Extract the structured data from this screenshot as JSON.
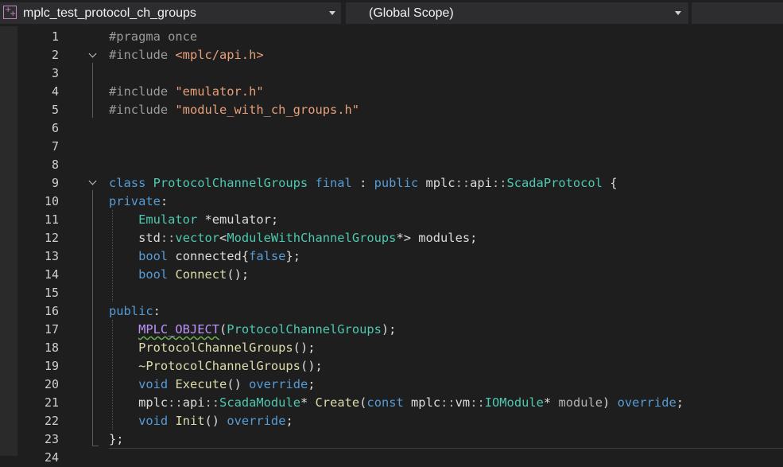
{
  "toolbar": {
    "project_dropdown": "mplc_test_protocol_ch_groups",
    "scope_dropdown": "(Global Scope)"
  },
  "editor": {
    "line_numbers": [
      "1",
      "2",
      "3",
      "4",
      "5",
      "6",
      "7",
      "8",
      "9",
      "10",
      "11",
      "12",
      "13",
      "14",
      "15",
      "16",
      "17",
      "18",
      "19",
      "20",
      "21",
      "22",
      "23",
      "24"
    ],
    "lines": [
      [
        [
          "pp",
          "#pragma once"
        ]
      ],
      [
        [
          "pp",
          "#include "
        ],
        [
          "str",
          "<mplc/api.h>"
        ]
      ],
      [],
      [
        [
          "pp",
          "#include "
        ],
        [
          "str",
          "\"emulator.h\""
        ]
      ],
      [
        [
          "pp",
          "#include "
        ],
        [
          "str",
          "\"module_with_ch_groups.h\""
        ]
      ],
      [],
      [],
      [],
      [
        [
          "kw",
          "class "
        ],
        [
          "ty",
          "ProtocolChannelGroups "
        ],
        [
          "kw",
          "final"
        ],
        [
          "id",
          " : "
        ],
        [
          "kw",
          "public "
        ],
        [
          "id",
          "mplc"
        ],
        [
          "pt",
          "::"
        ],
        [
          "id",
          "api"
        ],
        [
          "pt",
          "::"
        ],
        [
          "ty",
          "ScadaProtocol"
        ],
        [
          "id",
          " {"
        ]
      ],
      [
        [
          "kw",
          "private"
        ],
        [
          "id",
          ":"
        ]
      ],
      [
        [
          "id",
          "    "
        ],
        [
          "ty",
          "Emulator"
        ],
        [
          "id",
          " *emulator;"
        ]
      ],
      [
        [
          "id",
          "    std"
        ],
        [
          "pt",
          "::"
        ],
        [
          "ty",
          "vector"
        ],
        [
          "id",
          "<"
        ],
        [
          "ty",
          "ModuleWithChannelGroups"
        ],
        [
          "id",
          "*> modules;"
        ]
      ],
      [
        [
          "id",
          "    "
        ],
        [
          "kw",
          "bool"
        ],
        [
          "id",
          " connected{"
        ],
        [
          "kw",
          "false"
        ],
        [
          "id",
          "};"
        ]
      ],
      [
        [
          "id",
          "    "
        ],
        [
          "kw",
          "bool"
        ],
        [
          "id",
          " "
        ],
        [
          "fn",
          "Connect"
        ],
        [
          "id",
          "();"
        ]
      ],
      [],
      [
        [
          "kw",
          "public"
        ],
        [
          "id",
          ":"
        ]
      ],
      [
        [
          "id",
          "    "
        ],
        [
          "mac",
          "MPLC_OBJECT"
        ],
        [
          "id",
          "("
        ],
        [
          "ty",
          "ProtocolChannelGroups"
        ],
        [
          "id",
          ");"
        ]
      ],
      [
        [
          "id",
          "    "
        ],
        [
          "fn",
          "ProtocolChannelGroups"
        ],
        [
          "id",
          "();"
        ]
      ],
      [
        [
          "id",
          "    "
        ],
        [
          "fn",
          "~ProtocolChannelGroups"
        ],
        [
          "id",
          "();"
        ]
      ],
      [
        [
          "id",
          "    "
        ],
        [
          "kw",
          "void"
        ],
        [
          "id",
          " "
        ],
        [
          "fn",
          "Execute"
        ],
        [
          "id",
          "() "
        ],
        [
          "kw",
          "override"
        ],
        [
          "id",
          ";"
        ]
      ],
      [
        [
          "id",
          "    mplc"
        ],
        [
          "pt",
          "::"
        ],
        [
          "id",
          "api"
        ],
        [
          "pt",
          "::"
        ],
        [
          "ty",
          "ScadaModule"
        ],
        [
          "id",
          "* "
        ],
        [
          "fn",
          "Create"
        ],
        [
          "id",
          "("
        ],
        [
          "kw",
          "const"
        ],
        [
          "id",
          " mplc"
        ],
        [
          "pt",
          "::"
        ],
        [
          "id",
          "vm"
        ],
        [
          "pt",
          "::"
        ],
        [
          "ty",
          "IOModule"
        ],
        [
          "id",
          "* "
        ],
        [
          "pt",
          "module"
        ],
        [
          "id",
          ") "
        ],
        [
          "kw",
          "override"
        ],
        [
          "id",
          ";"
        ]
      ],
      [
        [
          "id",
          "    "
        ],
        [
          "kw",
          "void"
        ],
        [
          "id",
          " "
        ],
        [
          "fn",
          "Init"
        ],
        [
          "id",
          "() "
        ],
        [
          "kw",
          "override"
        ],
        [
          "id",
          ";"
        ]
      ],
      [
        [
          "id",
          "};"
        ]
      ],
      []
    ]
  },
  "colors": {
    "background": "#1e1e1e",
    "keyword": "#569cd6",
    "type": "#4ec9b0",
    "string": "#e8a07a",
    "function": "#dcdcaa",
    "macro": "#bd93f9"
  }
}
